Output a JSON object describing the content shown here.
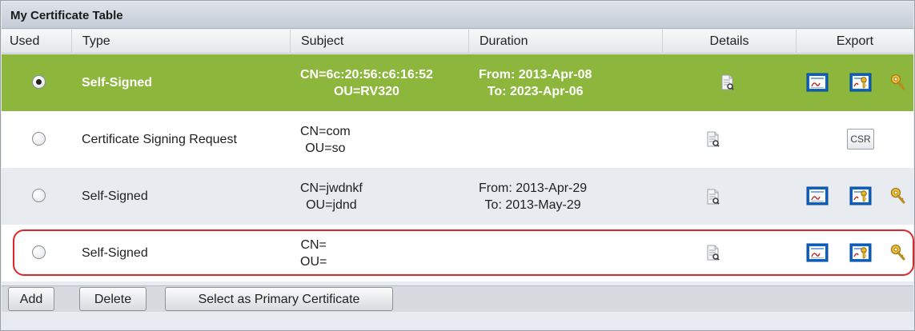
{
  "table": {
    "title": "My Certificate Table",
    "columns": {
      "used": "Used",
      "type": "Type",
      "subject": "Subject",
      "duration": "Duration",
      "details": "Details",
      "export": "Export"
    },
    "rows": [
      {
        "selected": true,
        "type": "Self-Signed",
        "subject_cn": "CN=6c:20:56:c6:16:52",
        "subject_ou": "OU=RV320",
        "duration_from": "From: 2013-Apr-08",
        "duration_to": "To: 2023-Apr-06",
        "details_icon": "certificate-details-icon",
        "export_icons": [
          "export-certificate-icon",
          "export-certificate-key-icon",
          "export-private-key-icon"
        ]
      },
      {
        "selected": false,
        "type": "Certificate Signing Request",
        "subject_cn": "CN=com",
        "subject_ou": "OU=so",
        "duration_from": "",
        "duration_to": "",
        "details_icon": "certificate-details-icon",
        "export_label": "CSR"
      },
      {
        "selected": false,
        "type": "Self-Signed",
        "subject_cn": "CN=jwdnkf",
        "subject_ou": "OU=jdnd",
        "duration_from": "From: 2013-Apr-29",
        "duration_to": "To: 2013-May-29",
        "details_icon": "certificate-details-icon",
        "export_icons": [
          "export-certificate-icon",
          "export-certificate-key-icon",
          "export-private-key-icon"
        ]
      },
      {
        "selected": false,
        "type": "Self-Signed",
        "subject_cn": "CN=",
        "subject_ou": "OU=",
        "duration_from": "",
        "duration_to": "",
        "details_icon": "certificate-details-icon",
        "export_icons": [
          "export-certificate-icon",
          "export-certificate-key-icon",
          "export-private-key-icon"
        ]
      }
    ]
  },
  "buttons": {
    "add": "Add",
    "delete": "Delete",
    "primary": "Select as Primary Certificate"
  },
  "colors": {
    "selected_row": "#8cb63c",
    "title_bar": "#c4ccd6",
    "highlight_outline": "#e0262a"
  }
}
